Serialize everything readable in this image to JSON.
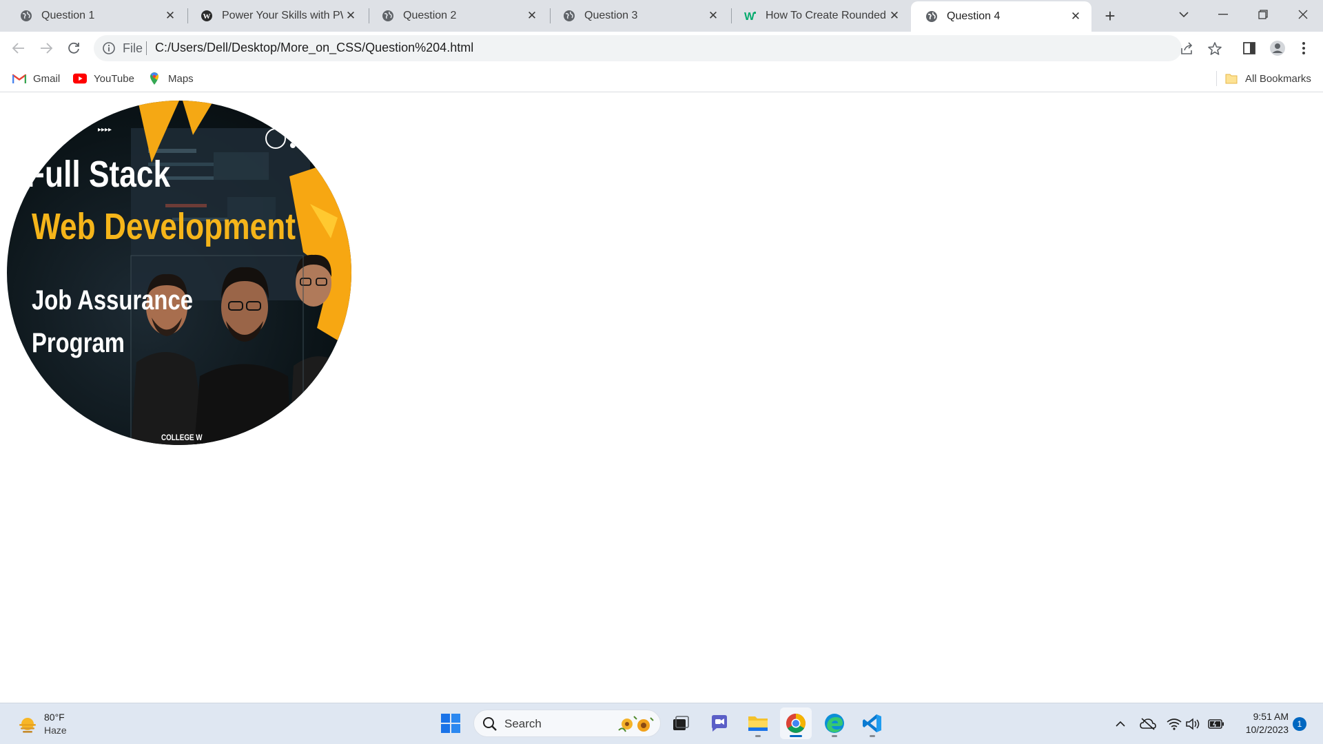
{
  "browser": {
    "tabs": [
      {
        "title": "Question 1",
        "icon": "globe-icon",
        "active": false
      },
      {
        "title": "Power Your Skills with PW Skills",
        "icon": "wordpress-icon",
        "active": false
      },
      {
        "title": "Question 2",
        "icon": "globe-icon",
        "active": false
      },
      {
        "title": "Question 3",
        "icon": "globe-icon",
        "active": false
      },
      {
        "title": "How To Create Rounded Images",
        "icon": "w3schools-icon",
        "active": false
      },
      {
        "title": "Question 4",
        "icon": "globe-icon",
        "active": true
      }
    ],
    "address_bar": {
      "scheme_label": "File",
      "url": "C:/Users/Dell/Desktop/More_on_CSS/Question%204.html"
    },
    "bookmarks": [
      {
        "label": "Gmail",
        "icon": "gmail-icon"
      },
      {
        "label": "YouTube",
        "icon": "youtube-icon"
      },
      {
        "label": "Maps",
        "icon": "maps-pin-icon"
      }
    ],
    "all_bookmarks_label": "All Bookmarks"
  },
  "page": {
    "image": {
      "line1": "Full Stack",
      "line2": "Web Development",
      "line3": "Job Assurance",
      "line4": "Program",
      "footer": "COLLEGE W"
    }
  },
  "taskbar": {
    "weather": {
      "temp": "80°F",
      "condition": "Haze"
    },
    "search_label": "Search",
    "apps": [
      "windows-start-icon",
      "task-view-icon",
      "teams-chat-icon",
      "file-explorer-icon",
      "chrome-icon",
      "edge-icon",
      "vscode-icon"
    ],
    "clock": {
      "time": "9:51 AM",
      "date": "10/2/2023"
    },
    "notification_count": "1"
  },
  "colors": {
    "tab_strip": "#dee1e6",
    "accent_yellow": "#f5b51a",
    "taskbar": "#dfe7f2",
    "windows_blue": "#0067c0"
  }
}
